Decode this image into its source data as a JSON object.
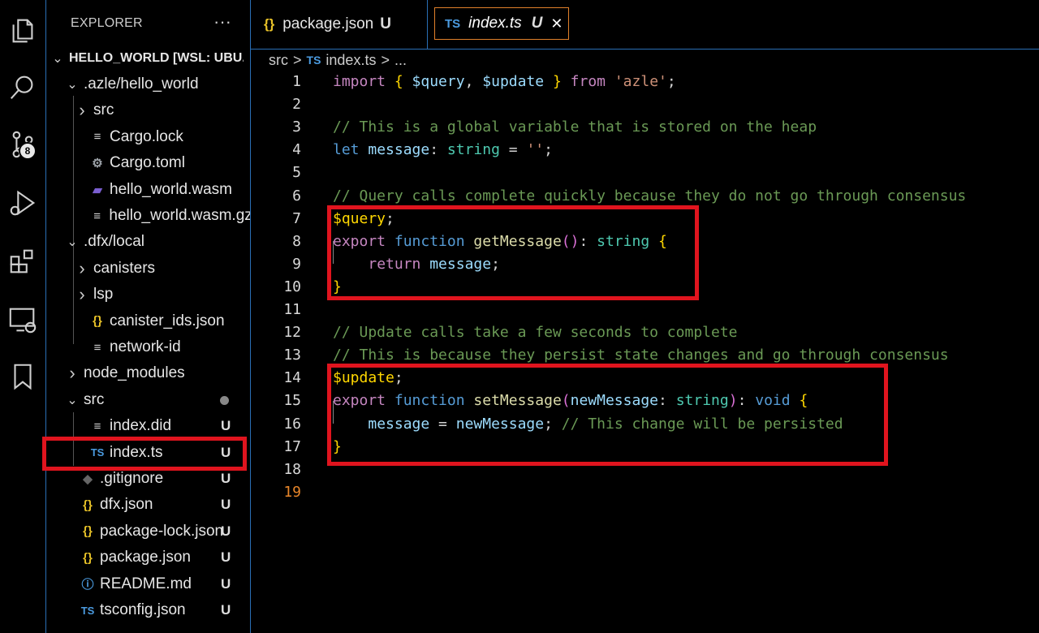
{
  "activity_bar": {
    "items": [
      {
        "icon": "explorer-icon"
      },
      {
        "icon": "search-icon"
      },
      {
        "icon": "source-control-icon",
        "badge": "8"
      },
      {
        "icon": "run-debug-icon"
      },
      {
        "icon": "extensions-icon"
      },
      {
        "icon": "remote-explorer-icon"
      },
      {
        "icon": "bookmark-icon"
      }
    ]
  },
  "sidebar": {
    "title": "EXPLORER",
    "more": "···",
    "root": "HELLO_WORLD [WSL: UBU...",
    "tree": [
      {
        "label": ".azle/hello_world",
        "type": "folder-open",
        "indent": 1
      },
      {
        "label": "src",
        "type": "folder-closed",
        "indent": 2
      },
      {
        "label": "Cargo.lock",
        "type": "file-lines",
        "indent": 2
      },
      {
        "label": "Cargo.toml",
        "type": "file-gear",
        "indent": 2
      },
      {
        "label": "hello_world.wasm",
        "type": "file-wasm",
        "indent": 2
      },
      {
        "label": "hello_world.wasm.gz",
        "type": "file-lines",
        "indent": 2
      },
      {
        "label": ".dfx/local",
        "type": "folder-open",
        "indent": 1
      },
      {
        "label": "canisters",
        "type": "folder-closed",
        "indent": 2
      },
      {
        "label": "lsp",
        "type": "folder-closed",
        "indent": 2
      },
      {
        "label": "canister_ids.json",
        "type": "file-json",
        "indent": 2
      },
      {
        "label": "network-id",
        "type": "file-lines",
        "indent": 2
      },
      {
        "label": "node_modules",
        "type": "folder-closed",
        "indent": 1
      },
      {
        "label": "src",
        "type": "folder-open",
        "indent": 1,
        "dot": true
      },
      {
        "label": "index.did",
        "type": "file-lines",
        "indent": 2,
        "status": "U"
      },
      {
        "label": "index.ts",
        "type": "file-ts",
        "indent": 2,
        "status": "U",
        "selected": true
      },
      {
        "label": ".gitignore",
        "type": "file-git",
        "indent": 1,
        "status": "U"
      },
      {
        "label": "dfx.json",
        "type": "file-json",
        "indent": 1,
        "status": "U"
      },
      {
        "label": "package-lock.json",
        "type": "file-json",
        "indent": 1,
        "status": "U"
      },
      {
        "label": "package.json",
        "type": "file-json",
        "indent": 1,
        "status": "U"
      },
      {
        "label": "README.md",
        "type": "file-info",
        "indent": 1,
        "status": "U"
      },
      {
        "label": "tsconfig.json",
        "type": "file-tsconfig",
        "indent": 1,
        "status": "U"
      }
    ]
  },
  "tabs": [
    {
      "icon": "{}",
      "label": "package.json",
      "status": "U",
      "active": false
    },
    {
      "icon": "TS",
      "label": "index.ts",
      "status": "U",
      "active": true,
      "close": "✕"
    }
  ],
  "breadcrumb": {
    "folder": "src",
    "sep": ">",
    "icon": "TS",
    "file": "index.ts",
    "more": "..."
  },
  "editor": {
    "lines": [
      [
        [
          "kw2",
          "import "
        ],
        [
          "br",
          "{ "
        ],
        [
          "id",
          "$query"
        ],
        [
          "pl",
          ", "
        ],
        [
          "id",
          "$update"
        ],
        [
          "br",
          " }"
        ],
        [
          "kw2",
          " from "
        ],
        [
          "str",
          "'azle'"
        ],
        [
          "pl",
          ";"
        ]
      ],
      [],
      [
        [
          "cm",
          "// This is a global variable that is stored on the heap"
        ]
      ],
      [
        [
          "kw",
          "let "
        ],
        [
          "id",
          "message"
        ],
        [
          "pl",
          ": "
        ],
        [
          "ty",
          "string"
        ],
        [
          "pl",
          " = "
        ],
        [
          "str",
          "''"
        ],
        [
          "pl",
          ";"
        ]
      ],
      [],
      [
        [
          "cm",
          "// Query calls complete quickly because they do not go through consensus"
        ]
      ],
      [
        [
          "dec",
          "$query"
        ],
        [
          "pl",
          ";"
        ]
      ],
      [
        [
          "kw2",
          "export "
        ],
        [
          "kw",
          "function "
        ],
        [
          "fn",
          "getMessage"
        ],
        [
          "br2",
          "()"
        ],
        [
          "pl",
          ": "
        ],
        [
          "ty",
          "string"
        ],
        [
          "br",
          " {"
        ]
      ],
      [
        [
          "pl",
          "    "
        ],
        [
          "kw2",
          "return "
        ],
        [
          "id",
          "message"
        ],
        [
          "pl",
          ";"
        ]
      ],
      [
        [
          "br",
          "}"
        ]
      ],
      [],
      [
        [
          "cm",
          "// Update calls take a few seconds to complete"
        ]
      ],
      [
        [
          "cm",
          "// This is because they persist state changes and go through consensus"
        ]
      ],
      [
        [
          "dec",
          "$update"
        ],
        [
          "pl",
          ";"
        ]
      ],
      [
        [
          "kw2",
          "export "
        ],
        [
          "kw",
          "function "
        ],
        [
          "fn",
          "setMessage"
        ],
        [
          "br2",
          "("
        ],
        [
          "id",
          "newMessage"
        ],
        [
          "pl",
          ": "
        ],
        [
          "ty",
          "string"
        ],
        [
          "br2",
          ")"
        ],
        [
          "pl",
          ": "
        ],
        [
          "kw",
          "void"
        ],
        [
          "br",
          " {"
        ]
      ],
      [
        [
          "pl",
          "    "
        ],
        [
          "id",
          "message"
        ],
        [
          "pl",
          " = "
        ],
        [
          "id",
          "newMessage"
        ],
        [
          "pl",
          "; "
        ],
        [
          "cm",
          "// This change will be persisted"
        ]
      ],
      [
        [
          "br",
          "}"
        ]
      ],
      [],
      []
    ],
    "current_line": 19,
    "highlight_colors": {
      "box": "#e0141e",
      "current_line_number": "#e8862a"
    }
  }
}
